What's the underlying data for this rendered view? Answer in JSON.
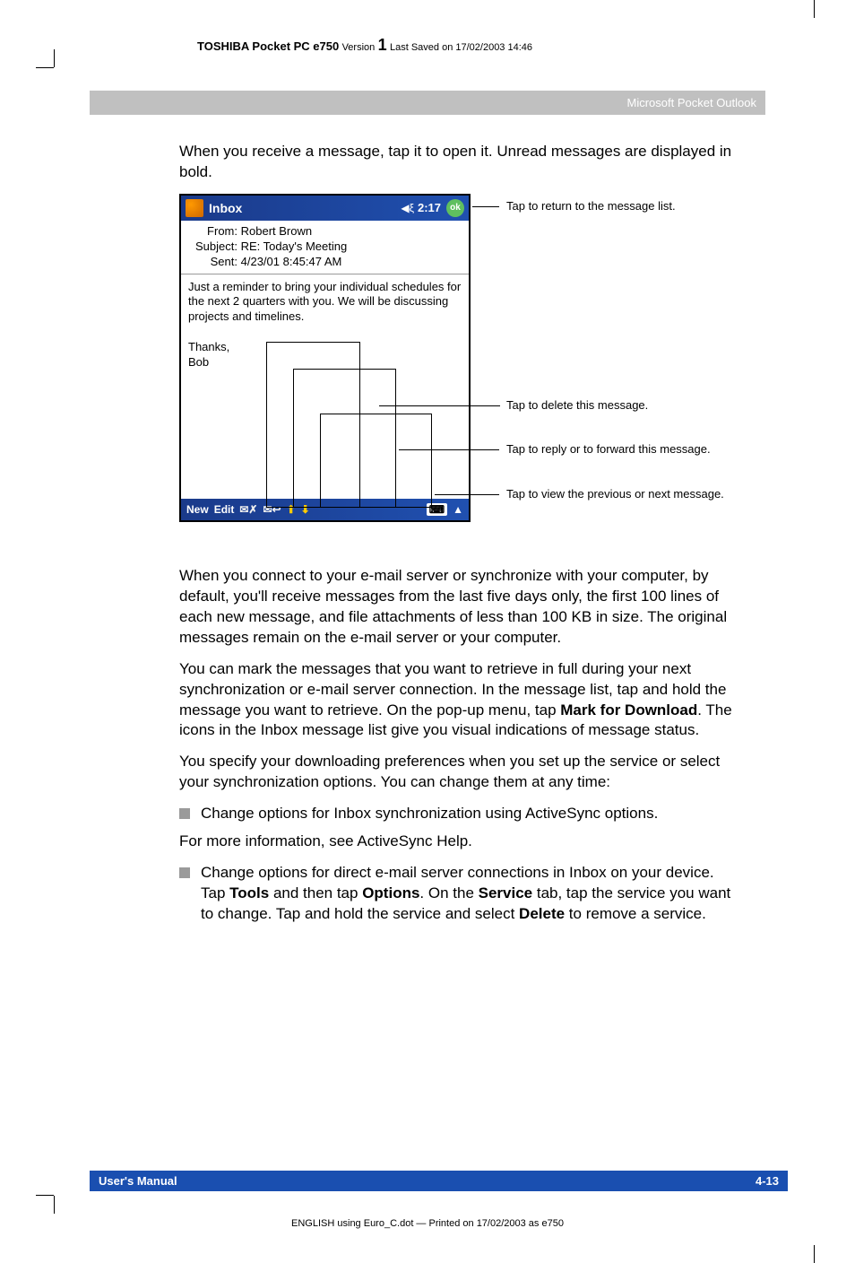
{
  "header": {
    "product": "TOSHIBA Pocket PC e750",
    "version_label": "Version",
    "version_num": "1",
    "saved": "Last Saved on 17/02/2003 14:46"
  },
  "section_title": "Microsoft Pocket Outlook",
  "intro": "When you receive a message, tap it to open it. Unread messages are displayed in bold.",
  "ppc": {
    "title": "Inbox",
    "time": "2:17",
    "ok": "ok",
    "from_label": "From:",
    "from_value": "Robert Brown",
    "subject_label": "Subject:",
    "subject_value": "RE: Today's Meeting",
    "sent_label": "Sent:",
    "sent_value": "4/23/01 8:45:47 AM",
    "body1": "Just a reminder to bring your individual schedules for the next 2 quarters with you. We will be discussing projects and timelines.",
    "body2": "Thanks,",
    "body3": "Bob",
    "tb_new": "New",
    "tb_edit": "Edit"
  },
  "callouts": {
    "c1": "Tap to return to the message list.",
    "c2": "Tap to delete this message.",
    "c3": "Tap to reply or to forward this message.",
    "c4": "Tap to view the previous or next message."
  },
  "para2": "When you connect to your e-mail server or synchronize with your computer, by default, you'll receive messages from the last five days only, the first 100 lines of each new message, and file attachments of less than 100 KB in size. The original messages remain on the e-mail server or your computer.",
  "para3a": "You can mark the messages that you want to retrieve in full during your next synchronization or e-mail server connection. In the message list, tap and hold the message you want to retrieve. On the pop-up menu, tap ",
  "para3b": "Mark for Download",
  "para3c": ". The icons in the Inbox message list give you visual indications of message status.",
  "para4": "You specify your downloading preferences when you set up the service or select your synchronization options. You can change them at any time:",
  "bullet1": "Change options for Inbox synchronization using ActiveSync options.",
  "para5": "For more information, see ActiveSync Help.",
  "bullet2a": "Change options for direct e-mail server connections in Inbox on your device. Tap ",
  "bullet2b": "Tools",
  "bullet2c": " and then tap ",
  "bullet2d": "Options",
  "bullet2e": ". On the ",
  "bullet2f": "Service",
  "bullet2g": " tab, tap the service you want to change. Tap and hold the service and select ",
  "bullet2h": "Delete",
  "bullet2i": " to remove a service.",
  "footer": {
    "left": "User's Manual",
    "right": "4-13"
  },
  "print_footer": "ENGLISH using Euro_C.dot — Printed on 17/02/2003 as e750"
}
